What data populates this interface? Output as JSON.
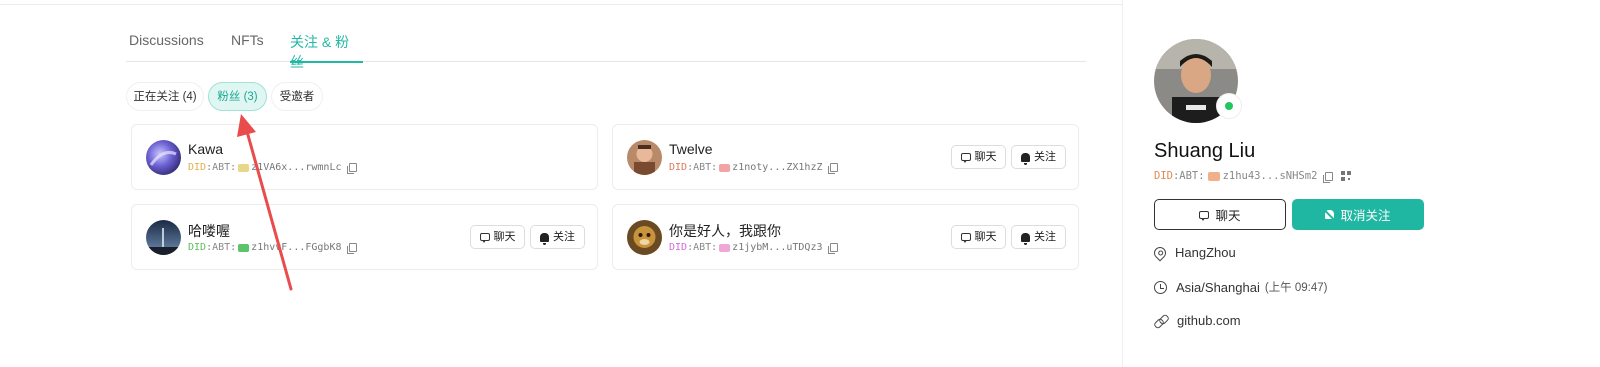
{
  "tabs": [
    {
      "label": "Discussions",
      "active": false
    },
    {
      "label": "NFTs",
      "active": false
    },
    {
      "label": "关注 & 粉丝",
      "active": true
    }
  ],
  "filters": [
    {
      "label": "正在关注 (4)",
      "active": false
    },
    {
      "label": "粉丝 (3)",
      "active": true
    },
    {
      "label": "受邀者",
      "active": false
    }
  ],
  "users": [
    {
      "name": "Kawa",
      "did_prefix": "DID",
      "did_mid": ":ABT:",
      "address": "z1VA6x...rwmnLc",
      "did_color": "#e0b050",
      "show_actions": false
    },
    {
      "name": "Twelve",
      "did_prefix": "DID",
      "did_mid": ":ABT:",
      "address": "z1noty...ZX1hzZ",
      "did_color": "#e07a5a",
      "show_actions": true
    },
    {
      "name": "哈喽喔",
      "did_prefix": "DID",
      "did_mid": ":ABT:",
      "address": "z1hvvF...FGgbK8",
      "did_color": "#5cbf5c",
      "show_actions": true
    },
    {
      "name": "你是好人，我跟你",
      "did_prefix": "DID",
      "did_mid": ":ABT:",
      "address": "z1jybM...uTDQz3",
      "did_color": "#d86ad8",
      "show_actions": true
    }
  ],
  "actions": {
    "chat_label": "聊天",
    "follow_label": "关注"
  },
  "profile": {
    "name": "Shuang Liu",
    "did_prefix": "DID",
    "did_mid": ":ABT:",
    "address": "z1hu43...sNHSm2",
    "did_color": "#e08a50",
    "chat_label": "聊天",
    "unfollow_label": "取消关注",
    "location": "HangZhou",
    "timezone": "Asia/Shanghai",
    "local_time": "(上午 09:47)",
    "link": "github.com"
  },
  "colors": {
    "accent": "#20b7a2",
    "online": "#22c55e",
    "annotation_arrow": "#e84c4c"
  }
}
